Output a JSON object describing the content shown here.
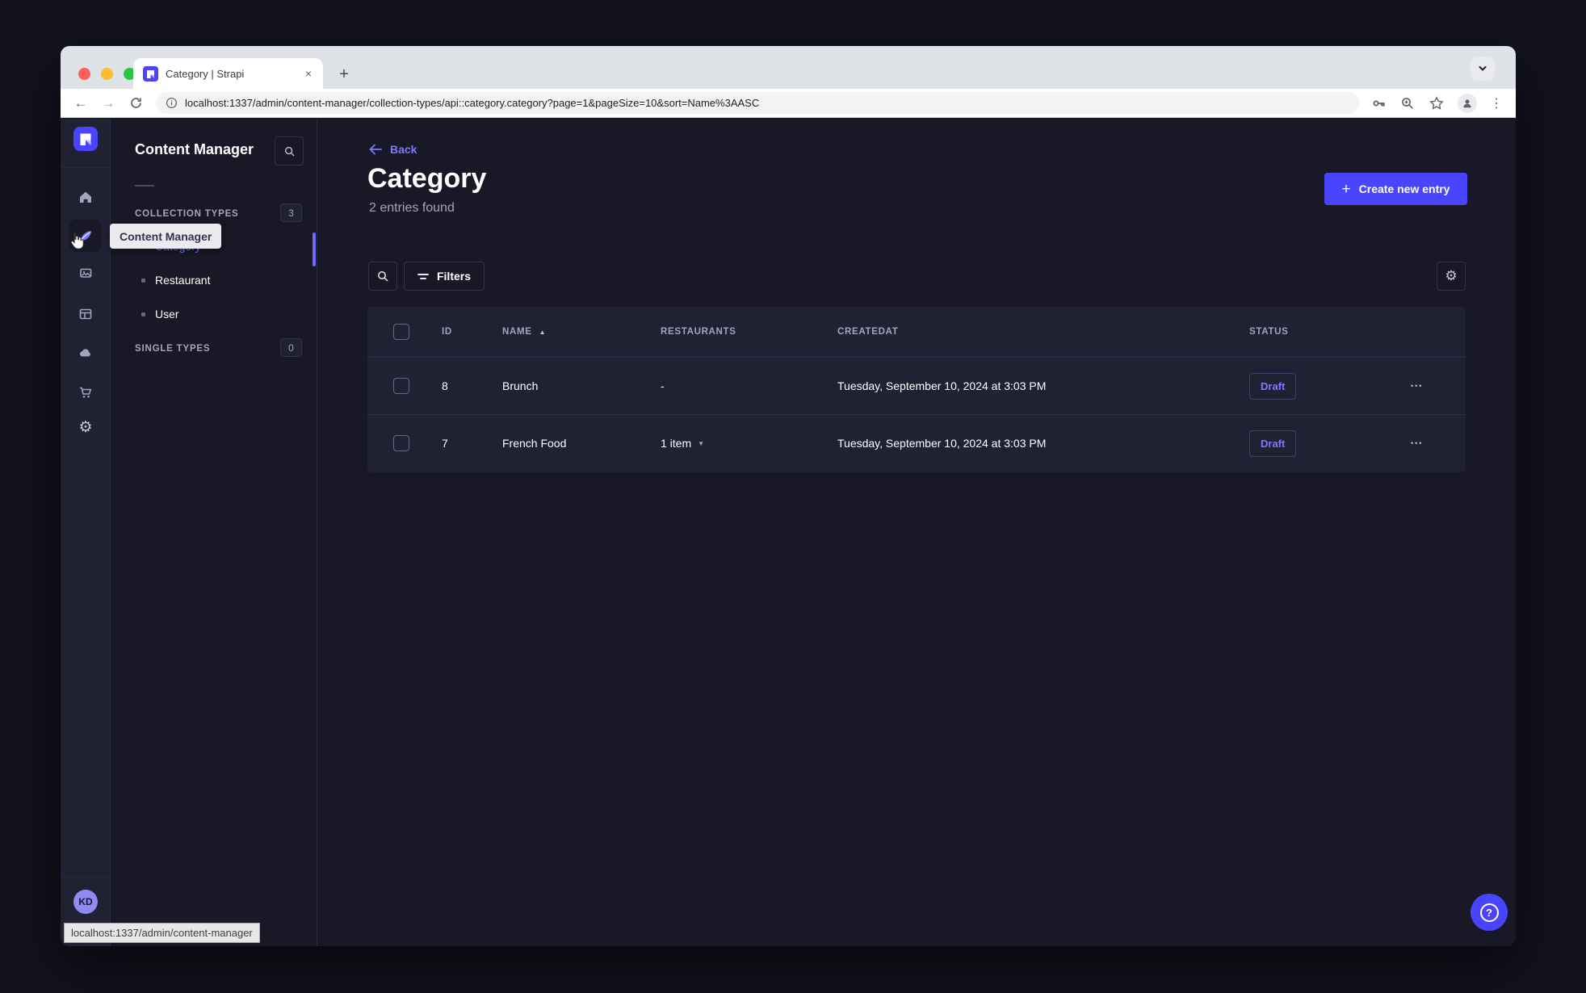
{
  "browser": {
    "tab_title": "Category | Strapi",
    "url": "localhost:1337/admin/content-manager/collection-types/api::category.category?page=1&pageSize=10&sort=Name%3AASC"
  },
  "nav_tooltip": "Content Manager",
  "subnav": {
    "title": "Content Manager",
    "collection_types": {
      "label": "COLLECTION TYPES",
      "count": "3"
    },
    "items": [
      {
        "label": "Category"
      },
      {
        "label": "Restaurant"
      },
      {
        "label": "User"
      }
    ],
    "single_types": {
      "label": "SINGLE TYPES",
      "count": "0"
    }
  },
  "page": {
    "back": "Back",
    "title": "Category",
    "subtitle": "2 entries found",
    "create_button": "Create new entry",
    "filters_button": "Filters"
  },
  "table": {
    "headers": {
      "id": "ID",
      "name": "NAME",
      "restaurants": "RESTAURANTS",
      "createdat": "CREATEDAT",
      "status": "STATUS"
    },
    "rows": [
      {
        "id": "8",
        "name": "Brunch",
        "restaurants": "-",
        "createdat": "Tuesday, September 10, 2024 at 3:03 PM",
        "status": "Draft"
      },
      {
        "id": "7",
        "name": "French Food",
        "restaurants": "1 item",
        "createdat": "Tuesday, September 10, 2024 at 3:03 PM",
        "status": "Draft"
      }
    ]
  },
  "footer": {
    "avatar_initials": "KD",
    "status_bar": "localhost:1337/admin/content-manager"
  },
  "colors": {
    "primary": "#4945ff",
    "primary_light": "#7b79ff",
    "app_bg": "#181826",
    "surface": "#212134",
    "border": "#32324d",
    "muted": "#a5a5ba"
  }
}
